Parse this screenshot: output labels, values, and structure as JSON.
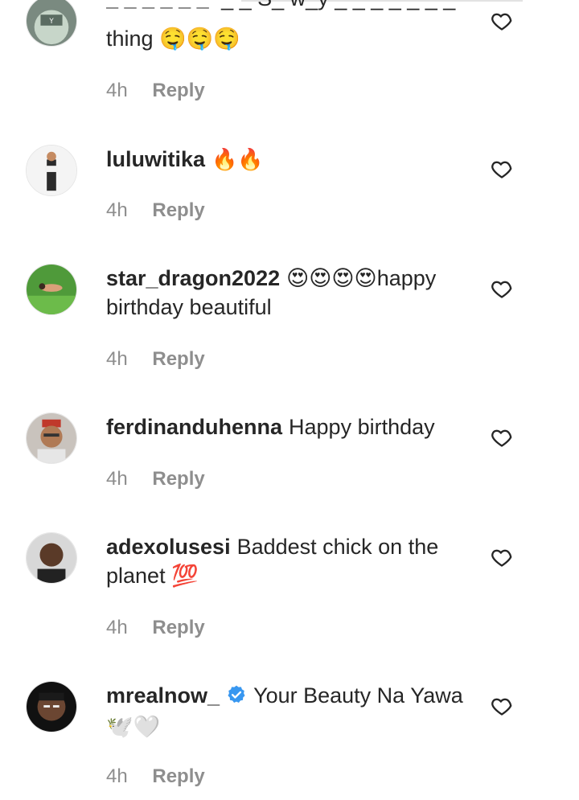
{
  "comments": [
    {
      "username": "",
      "text": "thing 🤤🤤🤤",
      "partial_top_text": "_ _ S_ w_y _ _ _ _ _ _ _",
      "time": "4h",
      "reply": "Reply"
    },
    {
      "username": "luluwitika",
      "text": "🔥🔥",
      "time": "4h",
      "reply": "Reply"
    },
    {
      "username": "star_dragon2022",
      "text": "😍😍😍😍happy birthday beautiful",
      "time": "4h",
      "reply": "Reply"
    },
    {
      "username": "ferdinanduhenna",
      "text": "Happy birthday",
      "time": "4h",
      "reply": "Reply"
    },
    {
      "username": "adexolusesi",
      "text": "Baddest chick on the planet 💯",
      "time": "4h",
      "reply": "Reply"
    },
    {
      "username": "mrealnow_",
      "text": "Your Beauty Na Yawa 🕊️🤍",
      "time": "4h",
      "reply": "Reply",
      "verified": true
    }
  ],
  "icons": {
    "like": "heart-outline-icon",
    "verified": "verified-badge-icon"
  },
  "colors": {
    "verified_blue": "#3897f0",
    "meta_gray": "#8e8e8e",
    "text": "#262626"
  }
}
